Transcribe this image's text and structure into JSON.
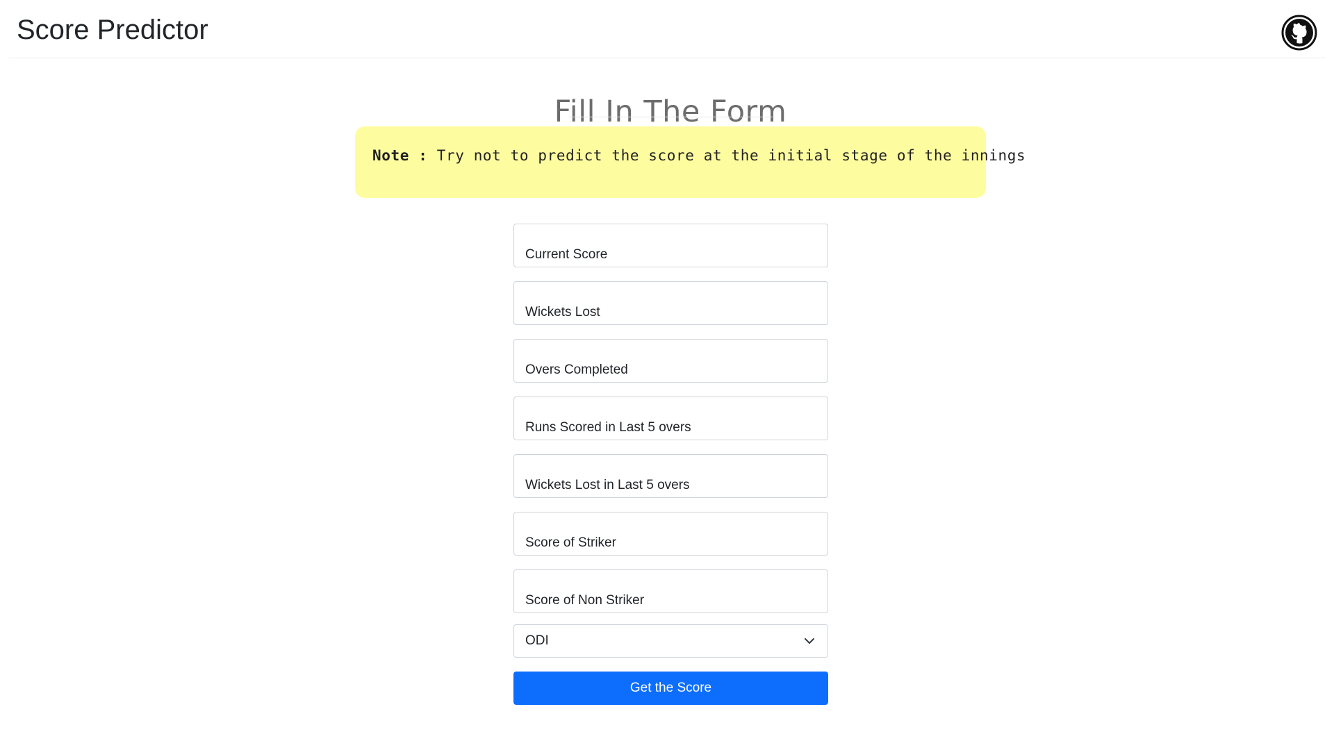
{
  "header": {
    "brand": "Score Predictor",
    "github_icon": "github-icon"
  },
  "main": {
    "title": "Fill In The Form",
    "note": {
      "label": "Note :",
      "text": "Try not to predict the score at the initial stage of the innings",
      "background": "#fdfda0"
    },
    "fields": [
      {
        "placeholder": "Current Score"
      },
      {
        "placeholder": "Wickets Lost"
      },
      {
        "placeholder": "Overs Completed"
      },
      {
        "placeholder": "Runs Scored in Last 5 overs"
      },
      {
        "placeholder": "Wickets Lost in Last 5 overs"
      },
      {
        "placeholder": "Score of Striker"
      },
      {
        "placeholder": "Score of Non Striker"
      }
    ],
    "match_type": {
      "selected": "ODI",
      "icon": "chevron-down-icon"
    },
    "submit_label": "Get the Score",
    "accent_color": "#0d6efd"
  }
}
